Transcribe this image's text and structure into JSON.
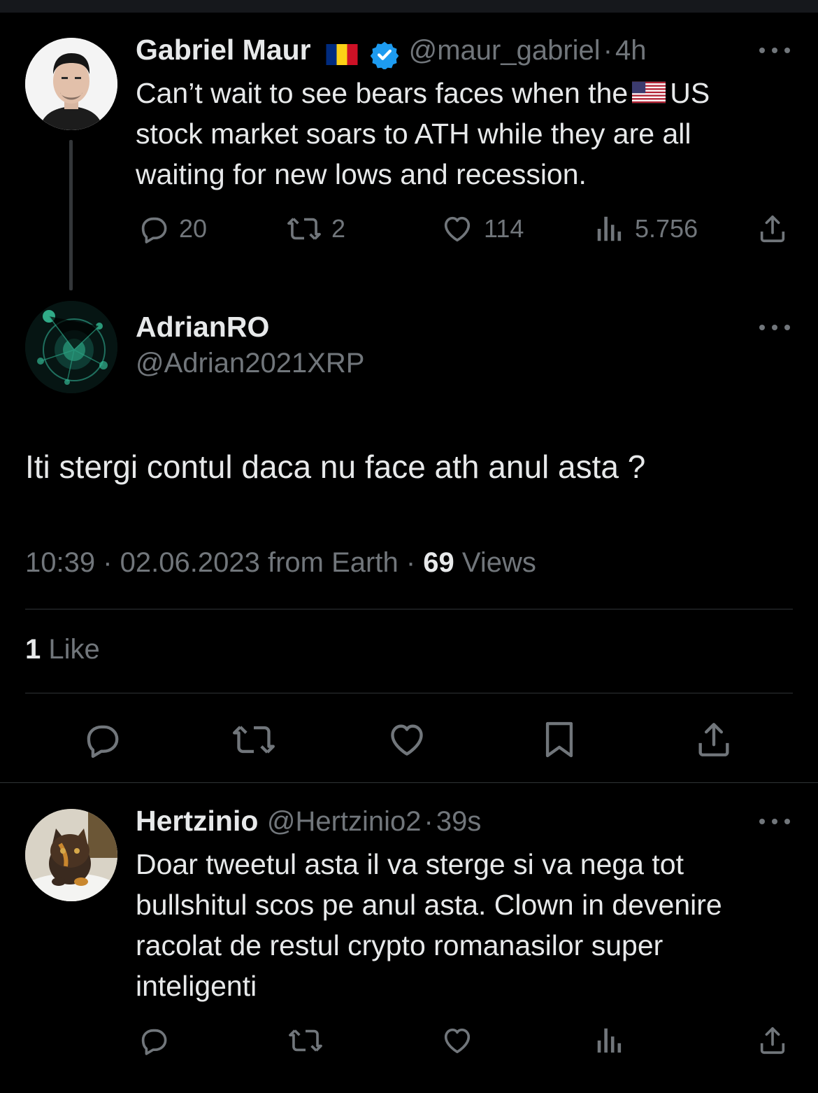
{
  "tweet1": {
    "name": "Gabriel Maur",
    "flag": "romania-flag",
    "verified": true,
    "handle": "@maur_gabriel",
    "sep": "·",
    "time": "4h",
    "text_before_flag": "Can’t wait to see bears faces when the",
    "text_flag": "us-flag",
    "text_after_flag": "US",
    "text_line2": "stock market soars to ATH while they are all",
    "text_line3": "waiting for new lows and recession.",
    "replies": "20",
    "retweets": "2",
    "likes": "114",
    "views": "5.756"
  },
  "tweet2": {
    "name": "AdrianRO",
    "handle": "@Adrian2021XRP",
    "text": "Iti stergi contul daca nu face ath anul asta ?",
    "time": "10:39",
    "date": "02.06.2023",
    "source": "from Earth",
    "views_count": "69",
    "views_label": "Views",
    "likes_count": "1",
    "likes_label": "Like"
  },
  "tweet3": {
    "name": "Hertzinio",
    "handle": "@Hertzinio2",
    "time": "39s",
    "line1": "Doar tweetul asta il va sterge si va nega tot",
    "line2": "bullshitul scos pe anul asta. Clown in devenire",
    "line3": "racolat de restul crypto romanasilor super",
    "line4": "inteligenti"
  },
  "colors": {
    "background": "#000000",
    "text": "#e7e9ea",
    "muted": "#71767b",
    "divider": "#2f3336",
    "verified": "#1d9bf0"
  }
}
